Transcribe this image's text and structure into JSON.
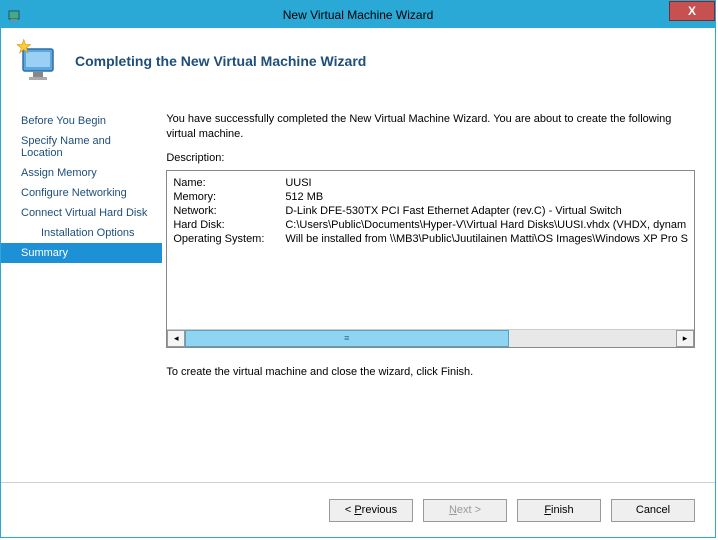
{
  "titlebar": {
    "title": "New Virtual Machine Wizard",
    "close": "X"
  },
  "header": {
    "heading": "Completing the New Virtual Machine Wizard"
  },
  "sidebar": {
    "items": [
      {
        "label": "Before You Begin",
        "indent": false,
        "selected": false
      },
      {
        "label": "Specify Name and Location",
        "indent": false,
        "selected": false
      },
      {
        "label": "Assign Memory",
        "indent": false,
        "selected": false
      },
      {
        "label": "Configure Networking",
        "indent": false,
        "selected": false
      },
      {
        "label": "Connect Virtual Hard Disk",
        "indent": false,
        "selected": false
      },
      {
        "label": "Installation Options",
        "indent": true,
        "selected": false
      },
      {
        "label": "Summary",
        "indent": false,
        "selected": true
      }
    ]
  },
  "main": {
    "intro": "You have successfully completed the New Virtual Machine Wizard. You are about to create the following virtual machine.",
    "description_label": "Description:",
    "summary": [
      {
        "key": "Name:",
        "value": "UUSI"
      },
      {
        "key": "Memory:",
        "value": "512 MB"
      },
      {
        "key": "Network:",
        "value": "D-Link DFE-530TX PCI Fast Ethernet Adapter (rev.C) - Virtual Switch"
      },
      {
        "key": "Hard Disk:",
        "value": "C:\\Users\\Public\\Documents\\Hyper-V\\Virtual Hard Disks\\UUSI.vhdx (VHDX, dynam"
      },
      {
        "key": "Operating System:",
        "value": "Will be installed from \\\\MB3\\Public\\Juutilainen Matti\\OS Images\\Windows XP Pro S"
      }
    ],
    "finish_note": "To create the virtual machine and close the wizard, click Finish."
  },
  "footer": {
    "previous_prefix": "< ",
    "previous_ul": "P",
    "previous_rest": "revious",
    "next_ul": "N",
    "next_rest": "ext >",
    "finish_ul": "F",
    "finish_rest": "inish",
    "cancel": "Cancel"
  }
}
